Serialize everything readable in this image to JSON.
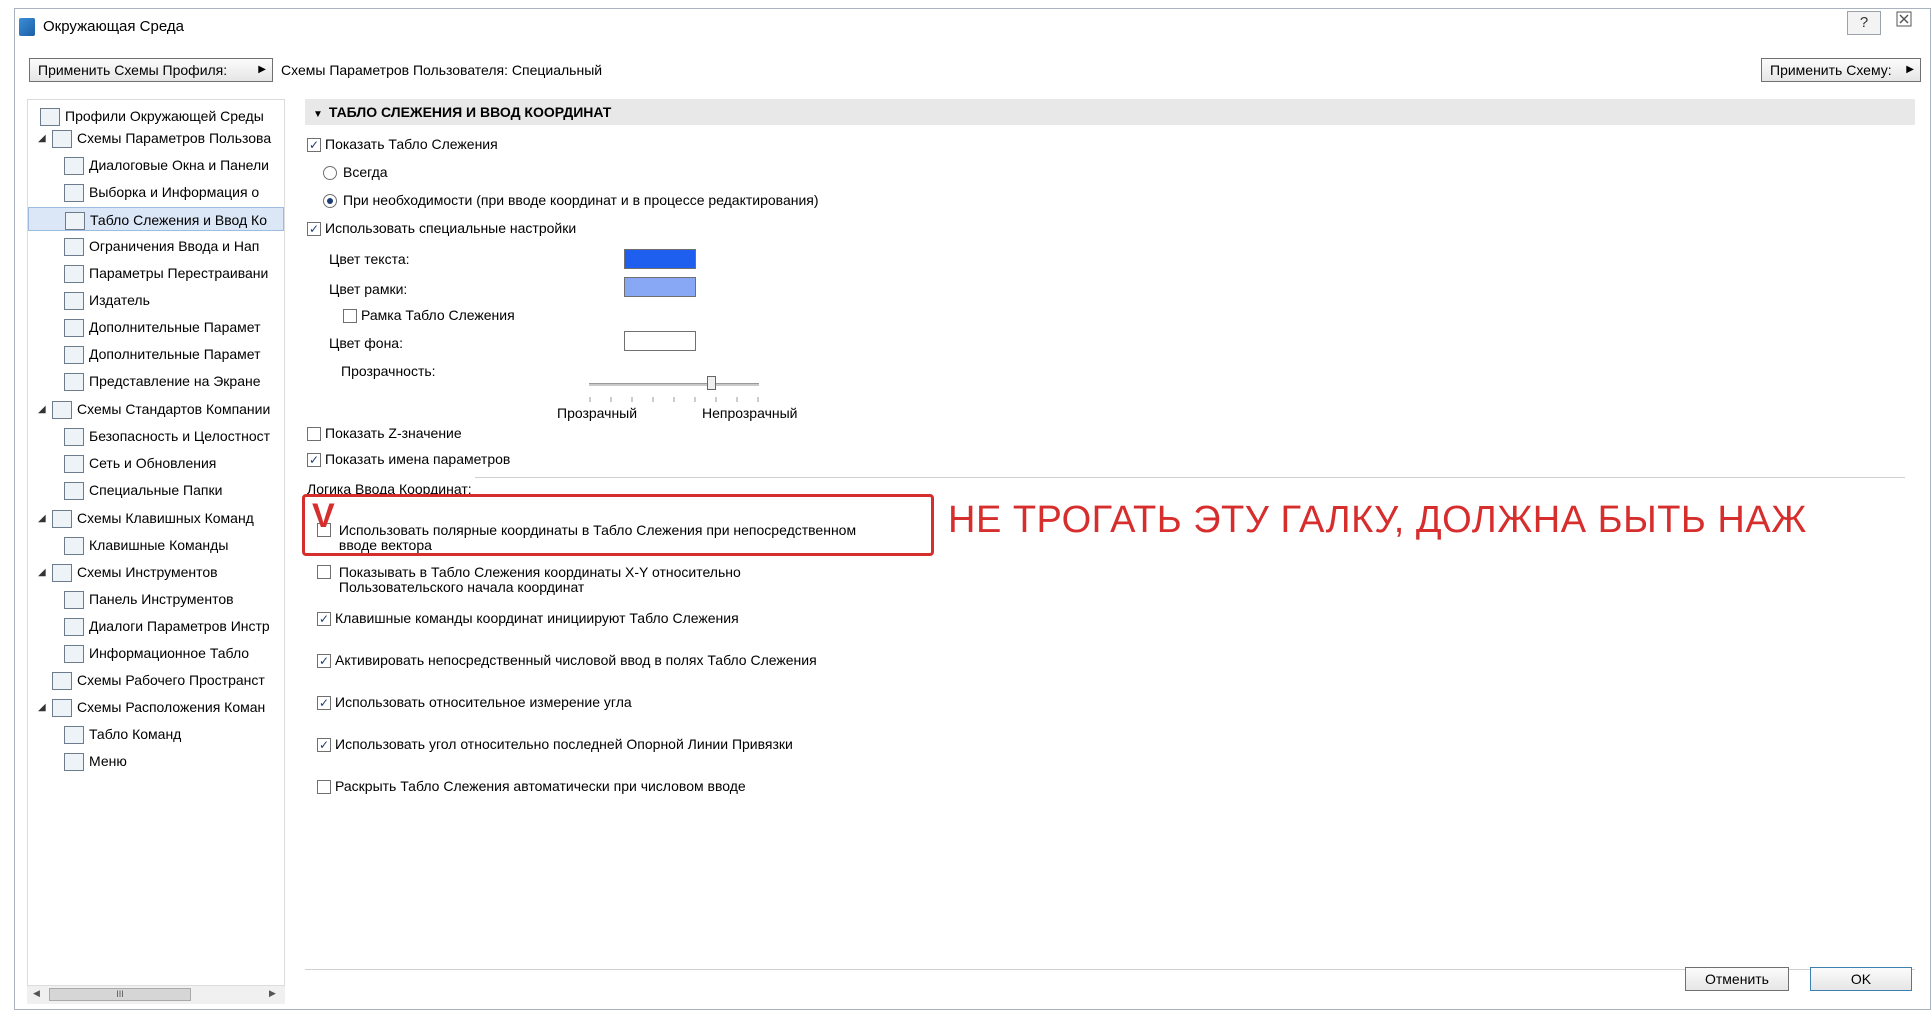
{
  "window": {
    "title": "Окружающая Среда",
    "help_label": "?",
    "close_label": "⛝"
  },
  "toolbar": {
    "apply_profile_label": "Применить Схемы Профиля:",
    "schemes_label": "Схемы Параметров Пользователя: Специальный",
    "apply_scheme_label": "Применить Схему:"
  },
  "sidebar": {
    "items": [
      {
        "label": "Профили Окружающей Среды",
        "icon": "profiles-icon"
      },
      {
        "label": "Схемы Параметров Пользова",
        "icon": "user-schemes-icon"
      },
      {
        "label": "Диалоговые Окна и Панели",
        "icon": "dialogs-icon"
      },
      {
        "label": "Выборка и Информация о",
        "icon": "selection-info-icon"
      },
      {
        "label": "Табло Слежения и Ввод Ко",
        "icon": "tracker-icon"
      },
      {
        "label": "Ограничения Ввода и Нап",
        "icon": "input-constraints-icon"
      },
      {
        "label": "Параметры Перестраивани",
        "icon": "rebuild-icon"
      },
      {
        "label": "Издатель",
        "icon": "publisher-icon"
      },
      {
        "label": "Дополнительные Парамет",
        "icon": "more-options-icon"
      },
      {
        "label": "Дополнительные Парамет",
        "icon": "more-options-2-icon"
      },
      {
        "label": "Представление на Экране",
        "icon": "display-icon"
      },
      {
        "label": "Схемы Стандартов Компании",
        "icon": "company-schemes-icon"
      },
      {
        "label": "Безопасность и Целостност",
        "icon": "security-icon"
      },
      {
        "label": "Сеть и Обновления",
        "icon": "network-icon"
      },
      {
        "label": "Специальные Папки",
        "icon": "folders-icon"
      },
      {
        "label": "Схемы Клавишных Команд",
        "icon": "shortcut-schemes-icon"
      },
      {
        "label": "Клавишные Команды",
        "icon": "shortcuts-icon"
      },
      {
        "label": "Схемы Инструментов",
        "icon": "tool-schemes-icon"
      },
      {
        "label": "Панель Инструментов",
        "icon": "toolbar-icon"
      },
      {
        "label": "Диалоги Параметров Инстр",
        "icon": "tool-dialogs-icon"
      },
      {
        "label": "Информационное Табло",
        "icon": "info-box-icon"
      },
      {
        "label": "Схемы Рабочего Пространст",
        "icon": "workspace-schemes-icon"
      },
      {
        "label": "Схемы Расположения Коман",
        "icon": "command-layout-icon"
      },
      {
        "label": "Табло Команд",
        "icon": "command-box-icon"
      },
      {
        "label": "Меню",
        "icon": "menu-icon"
      }
    ],
    "scroll_thumb": "III"
  },
  "section": {
    "title": "ТАБЛО СЛЕЖЕНИЯ И ВВОД КООРДИНАТ",
    "show_tracker": "Показать Табло Слежения",
    "always": "Всегда",
    "when_needed": "При необходимости (при вводе координат и в процессе редактирования)",
    "use_custom": "Использовать специальные настройки",
    "text_color": "Цвет текста:",
    "frame_color": "Цвет рамки:",
    "tracker_frame": "Рамка Табло Слежения",
    "bg_color": "Цвет фона:",
    "transparency": "Прозрачность:",
    "transparent": "Прозрачный",
    "opaque": "Непрозрачный",
    "show_z": "Показать Z-значение",
    "show_param_names": "Показать имена параметров",
    "logic_header": "Логика Ввода Координат:",
    "polar": "Использовать полярные координаты в Табло Слежения при непосредственном",
    "polar2": "вводе вектора",
    "xy_line1": "Показывать в Табло Слежения координаты X-Y относительно",
    "xy_line2": "Пользовательского начала координат",
    "keys_init": "Клавишные команды координат инициируют Табло Слежения",
    "direct_input": "Активировать непосредственный числовой ввод в полях Табло Слежения",
    "relative_angle": "Использовать относительное измерение угла",
    "last_ref_line": "Использовать угол относительно последней Опорной Линии Привязки",
    "expand_auto": "Раскрыть Табло Слежения автоматически при числовом вводе"
  },
  "colors": {
    "text_color": "#1f5ff0",
    "frame_color": "#88a8f5",
    "bg_color": "#ffffff",
    "annotation": "#d62d2d"
  },
  "slider": {
    "value_percent": 72
  },
  "annotation": {
    "text": "НЕ ТРОГАТЬ ЭТУ ГАЛКУ, ДОЛЖНА БЫТЬ НАЖ",
    "mark": "V"
  },
  "buttons": {
    "cancel": "Отменить",
    "ok": "OK"
  }
}
